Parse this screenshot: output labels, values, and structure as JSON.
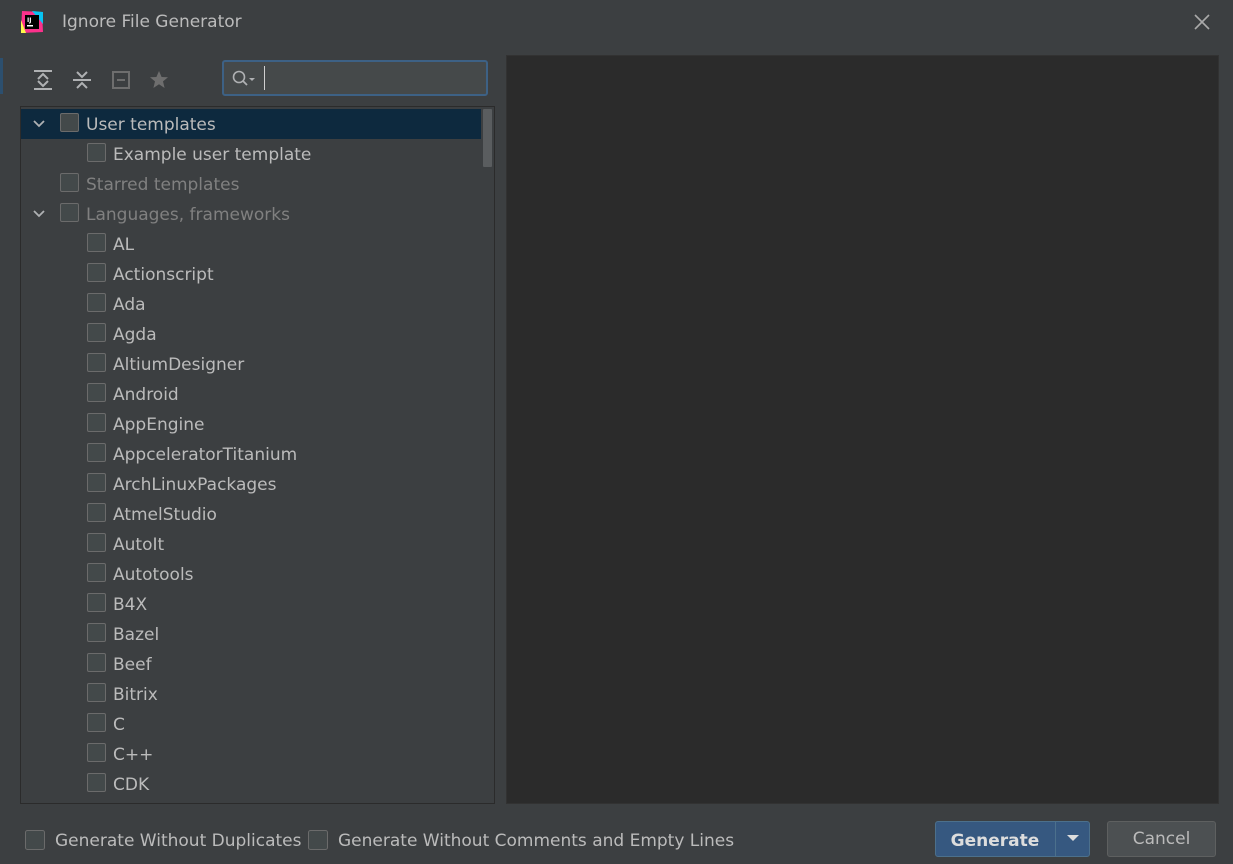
{
  "window": {
    "title": "Ignore File Generator"
  },
  "toolbar": {
    "buttons": [
      {
        "icon": "expand-all-icon"
      },
      {
        "icon": "collapse-all-icon"
      },
      {
        "icon": "uncheck-all-icon"
      },
      {
        "icon": "star-icon"
      }
    ],
    "search": {
      "value": "",
      "placeholder": ""
    }
  },
  "tree": {
    "rows": [
      {
        "label": "User templates",
        "level": 0,
        "expanded": true,
        "selected": true,
        "dim": false
      },
      {
        "label": "Example user template",
        "level": 1,
        "dim": false
      },
      {
        "label": "Starred templates",
        "level": 0,
        "dim": true
      },
      {
        "label": "Languages, frameworks",
        "level": 0,
        "expanded": true,
        "dim": true
      },
      {
        "label": "AL",
        "level": 1
      },
      {
        "label": "Actionscript",
        "level": 1
      },
      {
        "label": "Ada",
        "level": 1
      },
      {
        "label": "Agda",
        "level": 1
      },
      {
        "label": "AltiumDesigner",
        "level": 1
      },
      {
        "label": "Android",
        "level": 1
      },
      {
        "label": "AppEngine",
        "level": 1
      },
      {
        "label": "AppceleratorTitanium",
        "level": 1
      },
      {
        "label": "ArchLinuxPackages",
        "level": 1
      },
      {
        "label": "AtmelStudio",
        "level": 1
      },
      {
        "label": "AutoIt",
        "level": 1
      },
      {
        "label": "Autotools",
        "level": 1
      },
      {
        "label": "B4X",
        "level": 1
      },
      {
        "label": "Bazel",
        "level": 1
      },
      {
        "label": "Beef",
        "level": 1
      },
      {
        "label": "Bitrix",
        "level": 1
      },
      {
        "label": "C",
        "level": 1
      },
      {
        "label": "C++",
        "level": 1
      },
      {
        "label": "CDK",
        "level": 1
      }
    ]
  },
  "options": {
    "without_duplicates": "Generate Without Duplicates",
    "without_comments": "Generate Without Comments and Empty Lines"
  },
  "buttons": {
    "generate": "Generate",
    "cancel": "Cancel"
  },
  "colors": {
    "background": "#3c3f41",
    "preview_background": "#2b2b2b",
    "selection": "#0d293e",
    "primary_button": "#365880"
  }
}
